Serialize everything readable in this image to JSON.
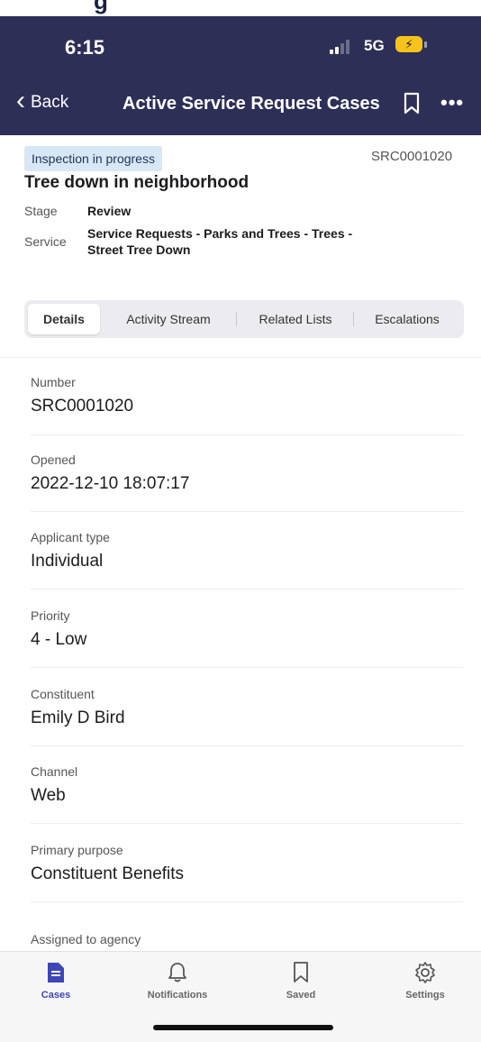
{
  "top_clip_text": "g",
  "status_bar": {
    "time": "6:15",
    "network": "5G",
    "battery_icon": "charging-bolt"
  },
  "nav": {
    "back_label": "Back",
    "title": "Active Service Request Cases"
  },
  "case": {
    "status_badge": "Inspection in progress",
    "number": "SRC0001020",
    "title": "Tree down in neighborhood",
    "stage_label": "Stage",
    "stage_value": "Review",
    "service_label": "Service",
    "service_value_line1": "Service Requests - Parks and Trees - Trees -",
    "service_value_line2": "Street Tree Down"
  },
  "tabs": [
    {
      "label": "Details",
      "active": true
    },
    {
      "label": "Activity Stream",
      "active": false
    },
    {
      "label": "Related Lists",
      "active": false
    },
    {
      "label": "Escalations",
      "active": false
    }
  ],
  "fields": [
    {
      "label": "Number",
      "value": "SRC0001020"
    },
    {
      "label": "Opened",
      "value": "2022-12-10 18:07:17"
    },
    {
      "label": "Applicant type",
      "value": "Individual"
    },
    {
      "label": "Priority",
      "value": "4 - Low"
    },
    {
      "label": "Constituent",
      "value": "Emily D Bird"
    },
    {
      "label": "Channel",
      "value": "Web"
    },
    {
      "label": "Primary purpose",
      "value": "Constituent Benefits"
    },
    {
      "label": "Assigned to agency",
      "value": ""
    }
  ],
  "tab_bar": [
    {
      "label": "Cases",
      "icon": "document-icon",
      "active": true
    },
    {
      "label": "Notifications",
      "icon": "bell-icon",
      "active": false
    },
    {
      "label": "Saved",
      "icon": "bookmark-icon",
      "active": false
    },
    {
      "label": "Settings",
      "icon": "gear-icon",
      "active": false
    }
  ],
  "colors": {
    "header_bg": "#2d2f57",
    "badge_bg": "#d7e7f6",
    "accent": "#3e45b6",
    "battery": "#f5c31b"
  }
}
